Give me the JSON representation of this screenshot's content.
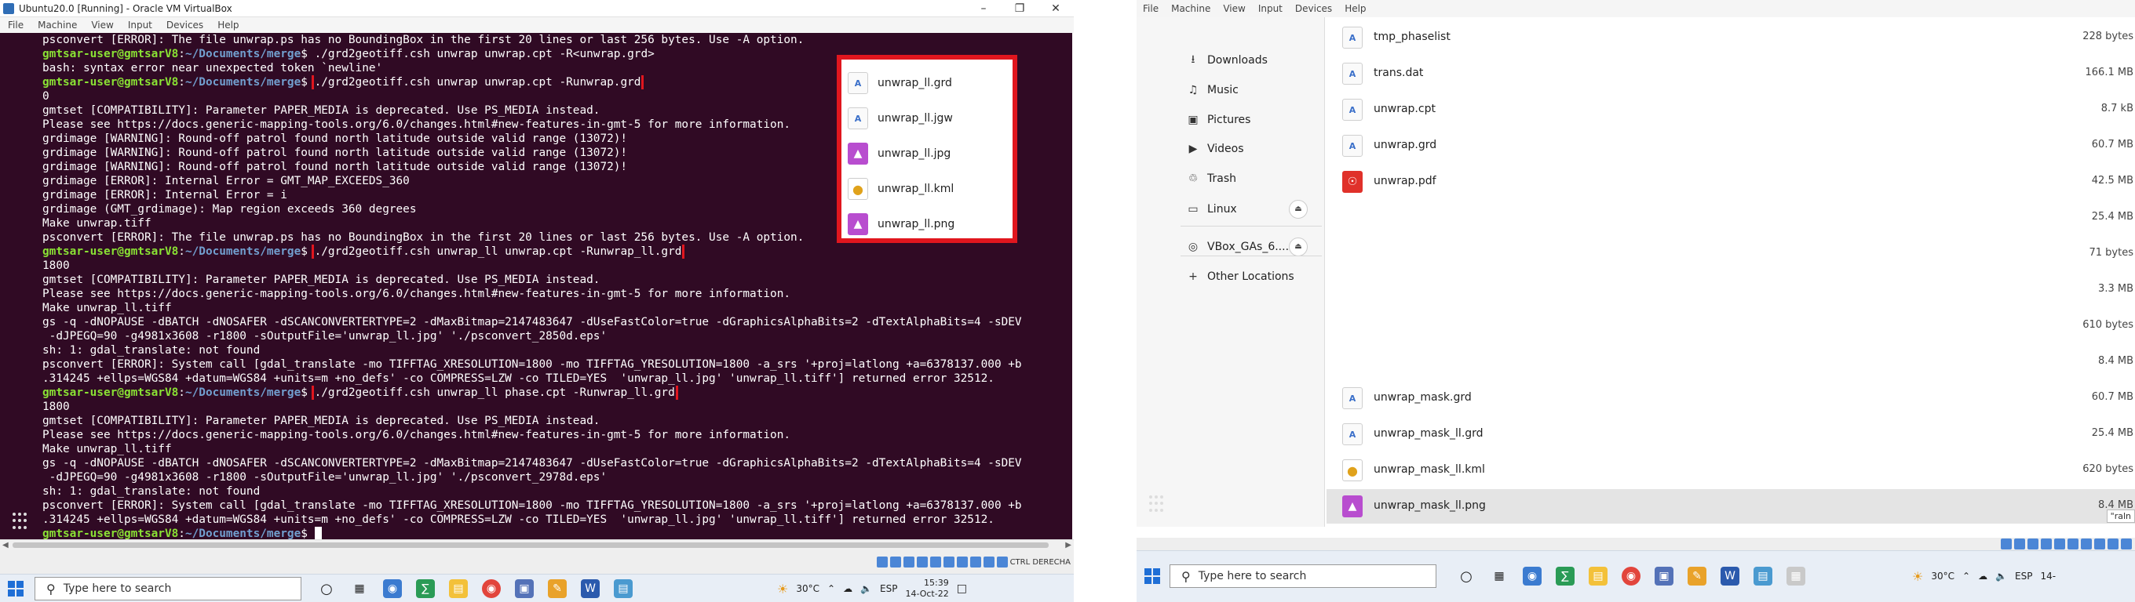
{
  "left": {
    "window_title": "Ubuntu20.0 [Running] - Oracle VM VirtualBox",
    "menu": [
      "File",
      "Machine",
      "View",
      "Input",
      "Devices",
      "Help"
    ],
    "terminal_lines": [
      [
        {
          "c": "o",
          "t": "psconvert [ERROR]: The file unwrap.ps has no BoundingBox in the first 20 lines or last 256 bytes. Use -A option."
        }
      ],
      [
        {
          "c": "p",
          "t": "gmtsar-user@gmtsarV8"
        },
        {
          "c": "o",
          "t": ":"
        },
        {
          "c": "d",
          "t": "~/Documents/merge"
        },
        {
          "c": "o",
          "t": "$ ./grd2geotiff.csh unwrap unwrap.cpt -R<unwrap.grd>"
        }
      ],
      [
        {
          "c": "o",
          "t": "bash: syntax error near unexpected token `newline'"
        }
      ],
      [
        {
          "c": "p",
          "t": "gmtsar-user@gmtsarV8"
        },
        {
          "c": "o",
          "t": ":"
        },
        {
          "c": "d",
          "t": "~/Documents/merge"
        },
        {
          "c": "o",
          "t": "$ "
        },
        {
          "c": "h",
          "t": "./grd2geotiff.csh unwrap unwrap.cpt -Runwrap.grd"
        }
      ],
      [
        {
          "c": "o",
          "t": "0"
        }
      ],
      [
        {
          "c": "o",
          "t": "gmtset [COMPATIBILITY]: Parameter PAPER_MEDIA is deprecated. Use PS_MEDIA instead."
        }
      ],
      [
        {
          "c": "o",
          "t": "Please see https://docs.generic-mapping-tools.org/6.0/changes.html#new-features-in-gmt-5 for more information."
        }
      ],
      [
        {
          "c": "o",
          "t": "grdimage [WARNING]: Round-off patrol found north latitude outside valid range (13072)!"
        }
      ],
      [
        {
          "c": "o",
          "t": "grdimage [WARNING]: Round-off patrol found north latitude outside valid range (13072)!"
        }
      ],
      [
        {
          "c": "o",
          "t": "grdimage [WARNING]: Round-off patrol found north latitude outside valid range (13072)!"
        }
      ],
      [
        {
          "c": "o",
          "t": "grdimage [ERROR]: Internal Error = GMT_MAP_EXCEEDS_360"
        }
      ],
      [
        {
          "c": "o",
          "t": "grdimage [ERROR]: Internal Error = i"
        }
      ],
      [
        {
          "c": "o",
          "t": "grdimage (GMT_grdimage): Map region exceeds 360 degrees"
        }
      ],
      [
        {
          "c": "o",
          "t": "Make unwrap.tiff"
        }
      ],
      [
        {
          "c": "o",
          "t": "psconvert [ERROR]: The file unwrap.ps has no BoundingBox in the first 20 lines or last 256 bytes. Use -A option."
        }
      ],
      [
        {
          "c": "p",
          "t": "gmtsar-user@gmtsarV8"
        },
        {
          "c": "o",
          "t": ":"
        },
        {
          "c": "d",
          "t": "~/Documents/merge"
        },
        {
          "c": "o",
          "t": "$ "
        },
        {
          "c": "h",
          "t": "./grd2geotiff.csh unwrap_ll unwrap.cpt -Runwrap_ll.grd"
        }
      ],
      [
        {
          "c": "o",
          "t": "1800"
        }
      ],
      [
        {
          "c": "o",
          "t": "gmtset [COMPATIBILITY]: Parameter PAPER_MEDIA is deprecated. Use PS_MEDIA instead."
        }
      ],
      [
        {
          "c": "o",
          "t": "Please see https://docs.generic-mapping-tools.org/6.0/changes.html#new-features-in-gmt-5 for more information."
        }
      ],
      [
        {
          "c": "o",
          "t": "Make unwrap_ll.tiff"
        }
      ],
      [
        {
          "c": "o",
          "t": "gs -q -dNOPAUSE -dBATCH -dNOSAFER -dSCANCONVERTERTYPE=2 -dMaxBitmap=2147483647 -dUseFastColor=true -dGraphicsAlphaBits=2 -dTextAlphaBits=4 -sDEV"
        }
      ],
      [
        {
          "c": "o",
          "t": " -dJPEGQ=90 -g4981x3608 -r1800 -sOutputFile='unwrap_ll.jpg' './psconvert_2850d.eps'"
        }
      ],
      [
        {
          "c": "o",
          "t": "sh: 1: gdal_translate: not found"
        }
      ],
      [
        {
          "c": "o",
          "t": "psconvert [ERROR]: System call [gdal_translate -mo TIFFTAG_XRESOLUTION=1800 -mo TIFFTAG_YRESOLUTION=1800 -a_srs '+proj=latlong +a=6378137.000 +b"
        }
      ],
      [
        {
          "c": "o",
          "t": ".314245 +ellps=WGS84 +datum=WGS84 +units=m +no_defs' -co COMPRESS=LZW -co TILED=YES  'unwrap_ll.jpg' 'unwrap_ll.tiff'] returned error 32512."
        }
      ],
      [
        {
          "c": "p",
          "t": "gmtsar-user@gmtsarV8"
        },
        {
          "c": "o",
          "t": ":"
        },
        {
          "c": "d",
          "t": "~/Documents/merge"
        },
        {
          "c": "o",
          "t": "$ "
        },
        {
          "c": "h",
          "t": "./grd2geotiff.csh unwrap_ll phase.cpt -Runwrap_ll.grd"
        }
      ],
      [
        {
          "c": "o",
          "t": "1800"
        }
      ],
      [
        {
          "c": "o",
          "t": "gmtset [COMPATIBILITY]: Parameter PAPER_MEDIA is deprecated. Use PS_MEDIA instead."
        }
      ],
      [
        {
          "c": "o",
          "t": "Please see https://docs.generic-mapping-tools.org/6.0/changes.html#new-features-in-gmt-5 for more information."
        }
      ],
      [
        {
          "c": "o",
          "t": "Make unwrap_ll.tiff"
        }
      ],
      [
        {
          "c": "o",
          "t": "gs -q -dNOPAUSE -dBATCH -dNOSAFER -dSCANCONVERTERTYPE=2 -dMaxBitmap=2147483647 -dUseFastColor=true -dGraphicsAlphaBits=2 -dTextAlphaBits=4 -sDEV"
        }
      ],
      [
        {
          "c": "o",
          "t": " -dJPEGQ=90 -g4981x3608 -r1800 -sOutputFile='unwrap_ll.jpg' './psconvert_2978d.eps'"
        }
      ],
      [
        {
          "c": "o",
          "t": "sh: 1: gdal_translate: not found"
        }
      ],
      [
        {
          "c": "o",
          "t": "psconvert [ERROR]: System call [gdal_translate -mo TIFFTAG_XRESOLUTION=1800 -mo TIFFTAG_YRESOLUTION=1800 -a_srs '+proj=latlong +a=6378137.000 +b"
        }
      ],
      [
        {
          "c": "o",
          "t": ".314245 +ellps=WGS84 +datum=WGS84 +units=m +no_defs' -co COMPRESS=LZW -co TILED=YES  'unwrap_ll.jpg' 'unwrap_ll.tiff'] returned error 32512."
        }
      ],
      [
        {
          "c": "p",
          "t": "gmtsar-user@gmtsarV8"
        },
        {
          "c": "o",
          "t": ":"
        },
        {
          "c": "d",
          "t": "~/Documents/merge"
        },
        {
          "c": "o",
          "t": "$ "
        },
        {
          "c": "cur",
          "t": ""
        }
      ]
    ],
    "popup_files": [
      {
        "name": "unwrap_ll.grd",
        "icon": "doc"
      },
      {
        "name": "unwrap_ll.jgw",
        "icon": "doc"
      },
      {
        "name": "unwrap_ll.jpg",
        "icon": "img"
      },
      {
        "name": "unwrap_ll.kml",
        "icon": "kml"
      },
      {
        "name": "unwrap_ll.png",
        "icon": "img"
      }
    ],
    "host_key": "CTRL DERECHA",
    "taskbar": {
      "search_placeholder": "Type here to search",
      "weather": "30°C",
      "lang": "ESP",
      "time": "15:39",
      "date": "14-Oct-22"
    }
  },
  "right": {
    "menu": [
      "File",
      "Machine",
      "View",
      "Input",
      "Devices",
      "Help"
    ],
    "sidebar": [
      {
        "label": "Downloads",
        "icon": "download-icon"
      },
      {
        "label": "Music",
        "icon": "music-icon"
      },
      {
        "label": "Pictures",
        "icon": "pictures-icon"
      },
      {
        "label": "Videos",
        "icon": "videos-icon"
      },
      {
        "label": "Trash",
        "icon": "trash-icon"
      },
      {
        "label": "Linux",
        "icon": "drive-icon"
      },
      {
        "label": "VBox_GAs_6....",
        "icon": "disc-icon"
      },
      {
        "label": "Other Locations",
        "icon": "plus-icon"
      }
    ],
    "files": [
      {
        "name": "tmp_phaselist",
        "size": "228 bytes",
        "icon": "doc"
      },
      {
        "name": "trans.dat",
        "size": "166.1 MB",
        "icon": "doc"
      },
      {
        "name": "unwrap.cpt",
        "size": "8.7 kB",
        "icon": "doc"
      },
      {
        "name": "unwrap.grd",
        "size": "60.7 MB",
        "icon": "doc"
      },
      {
        "name": "unwrap.pdf",
        "size": "42.5 MB",
        "icon": "pdf"
      },
      {
        "name": "",
        "size": "25.4 MB",
        "icon": "none"
      },
      {
        "name": "",
        "size": "71 bytes",
        "icon": "none"
      },
      {
        "name": "",
        "size": "3.3 MB",
        "icon": "none"
      },
      {
        "name": "",
        "size": "610 bytes",
        "icon": "none"
      },
      {
        "name": "",
        "size": "8.4 MB",
        "icon": "none"
      },
      {
        "name": "unwrap_mask.grd",
        "size": "60.7 MB",
        "icon": "doc"
      },
      {
        "name": "unwrap_mask_ll.grd",
        "size": "25.4 MB",
        "icon": "doc"
      },
      {
        "name": "unwrap_mask_ll.kml",
        "size": "620 bytes",
        "icon": "kml"
      },
      {
        "name": "unwrap_mask_ll.png",
        "size": "8.4 MB",
        "icon": "img"
      }
    ],
    "tooltip": "\"raln",
    "taskbar": {
      "search_placeholder": "Type here to search",
      "weather": "30°C",
      "lang": "ESP",
      "date": "14-"
    }
  },
  "colors": {
    "terminal_bg": "#300a24",
    "prompt": "#8ae234",
    "path": "#729fcf",
    "highlight": "#e0161e"
  }
}
